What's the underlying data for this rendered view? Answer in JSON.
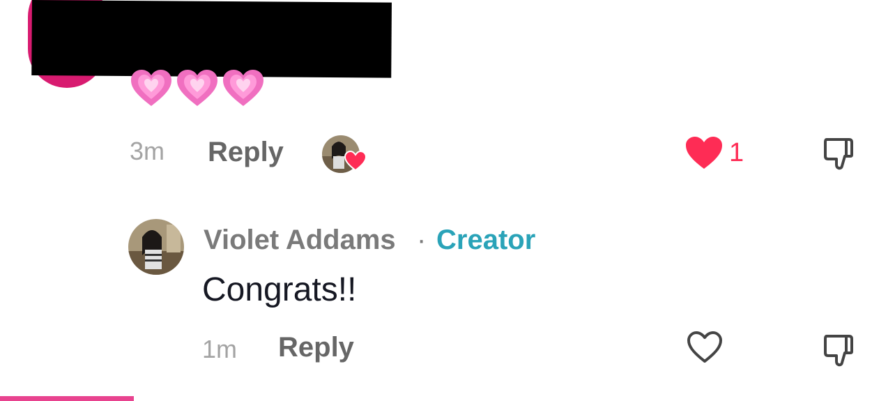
{
  "top_comment": {
    "time": "3m",
    "reply_label": "Reply",
    "like_count": "1",
    "like_color": "#fe2c55",
    "liked_by_creator": true,
    "icons": [
      "pink-heart-emoji",
      "pink-heart-emoji",
      "pink-heart-emoji",
      "heart-filled-icon",
      "thumbs-down-icon"
    ]
  },
  "reply_comment": {
    "author": "Violet Addams",
    "separator": "·",
    "badge": "Creator",
    "badge_color": "#2aa3b8",
    "text": "Congrats!!",
    "time": "1m",
    "reply_label": "Reply",
    "icons": [
      "heart-outline-icon",
      "thumbs-down-icon"
    ]
  }
}
